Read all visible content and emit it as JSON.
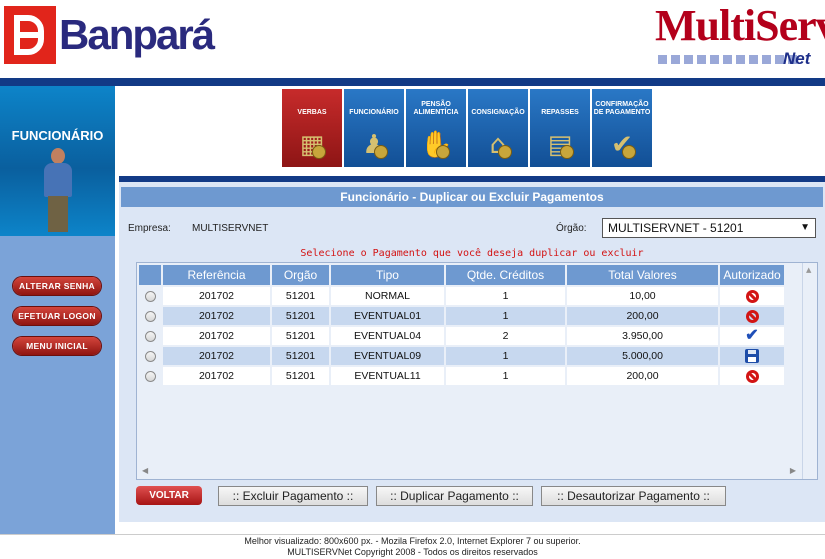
{
  "header": {
    "bank_name": "Banpará",
    "product_name": "MultiServ",
    "product_suffix": "Net"
  },
  "sidebar": {
    "section_title": "FUNCIONÁRIO",
    "buttons": [
      "ALTERAR SENHA",
      "EFETUAR LOGON",
      "MENU INICIAL"
    ]
  },
  "nav": {
    "tiles": [
      {
        "label": "VERBAS",
        "icon": "calculator-icon",
        "active": true
      },
      {
        "label": "FUNCIONÁRIO",
        "icon": "employee-icon",
        "active": false
      },
      {
        "label": "PENSÃO ALIMENTÍCIA",
        "icon": "handshake-icon",
        "active": false
      },
      {
        "label": "CONSIGNAÇÃO",
        "icon": "bank-building-icon",
        "active": false
      },
      {
        "label": "REPASSES",
        "icon": "money-stack-icon",
        "active": false
      },
      {
        "label": "CONFIRMAÇÃO DE PAGAMENTO",
        "icon": "checkmark-icon",
        "active": false
      }
    ]
  },
  "panel": {
    "title": "Funcionário - Duplicar ou Excluir Pagamentos",
    "empresa_label": "Empresa:",
    "empresa_value": "MULTISERVNET",
    "orgao_label": "Órgão:",
    "orgao_value": "MULTISERVNET - 51201",
    "hint": "Selecione o Pagamento que você deseja duplicar ou excluir"
  },
  "table": {
    "columns": [
      "Referência",
      "Orgão",
      "Tipo",
      "Qtde. Créditos",
      "Total Valores",
      "Autorizado"
    ],
    "rows": [
      {
        "referencia": "201702",
        "orgao": "51201",
        "tipo": "NORMAL",
        "qtde": "1",
        "total": "10,00",
        "status": "not-authorized-icon"
      },
      {
        "referencia": "201702",
        "orgao": "51201",
        "tipo": "EVENTUAL01",
        "qtde": "1",
        "total": "200,00",
        "status": "not-authorized-icon"
      },
      {
        "referencia": "201702",
        "orgao": "51201",
        "tipo": "EVENTUAL04",
        "qtde": "2",
        "total": "3.950,00",
        "status": "authorized-check-icon"
      },
      {
        "referencia": "201702",
        "orgao": "51201",
        "tipo": "EVENTUAL09",
        "qtde": "1",
        "total": "5.000,00",
        "status": "saved-disk-icon"
      },
      {
        "referencia": "201702",
        "orgao": "51201",
        "tipo": "EVENTUAL11",
        "qtde": "1",
        "total": "200,00",
        "status": "not-authorized-icon"
      }
    ]
  },
  "actions": {
    "voltar": "VOLTAR",
    "excluir": ":: Excluir Pagamento ::",
    "duplicar": ":: Duplicar Pagamento ::",
    "desautorizar": ":: Desautorizar Pagamento ::"
  },
  "footer": {
    "line1": "Melhor visualizado: 800x600 px. - Mozila Firefox 2.0, Internet Explorer 7 ou superior.",
    "line2": "MULTISERVNet Copyright 2008 - Todos os direitos reservados"
  },
  "colors": {
    "brand_blue": "#123a86",
    "header_cell": "#6e99d0",
    "accent_red": "#b3001b"
  }
}
